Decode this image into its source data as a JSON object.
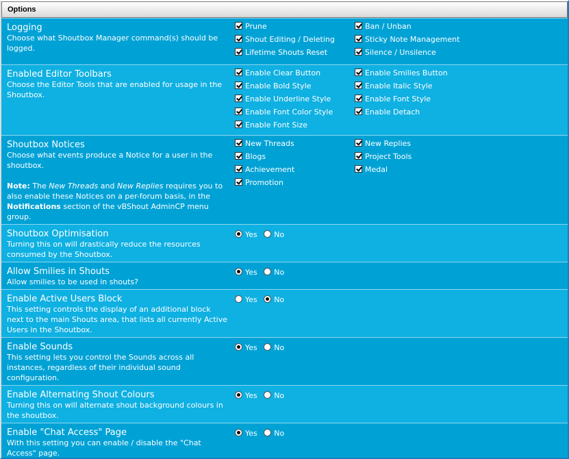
{
  "section_title": "Options",
  "logging": {
    "title": "Logging",
    "desc": "Choose what Shoutbox Manager command(s) should be logged.",
    "options": [
      "Prune",
      "Ban / Unban",
      "Shout Editing / Deleting",
      "Sticky Note Management",
      "Lifetime Shouts Reset",
      "Silence / Unsilence"
    ]
  },
  "toolbars": {
    "title": "Enabled Editor Toolbars",
    "desc": "Choose the Editor Tools that are enabled for usage in the Shoutbox.",
    "options": [
      "Enable Clear Button",
      "Enable Smilies Button",
      "Enable Bold Style",
      "Enable Italic Style",
      "Enable Underline Style",
      "Enable Font Style",
      "Enable Font Color Style",
      "Enable Detach",
      "Enable Font Size"
    ]
  },
  "notices": {
    "title": "Shoutbox Notices",
    "desc": "Choose what events produce a Notice for a user in the shoutbox.",
    "note_label": "Note:",
    "note_t1": " The ",
    "note_new_threads": "New Threads",
    "note_t2": " and ",
    "note_new_replies": "New Replies",
    "note_t3": " requires you to also enable these Notices on a per-forum basis, in the ",
    "note_notifications": "Notifications",
    "note_t4": " section of the vBShout AdminCP menu group.",
    "options": [
      "New Threads",
      "New Replies",
      "Blogs",
      "Project Tools",
      "Achievement",
      "Medal",
      "Promotion"
    ]
  },
  "yes_label": "Yes",
  "no_label": "No",
  "radio_settings": [
    {
      "title": "Shoutbox Optimisation",
      "desc": "Turning this on will drastically reduce the resources consumed by the Shoutbox.",
      "value": "yes"
    },
    {
      "title": "Allow Smilies in Shouts",
      "desc": "Allow smilies to be used in shouts?",
      "value": "yes"
    },
    {
      "title": "Enable Active Users Block",
      "desc": "This setting controls the display of an additional block next to the main Shouts area, that lists all currently Active Users in the Shoutbox.",
      "value": "no"
    },
    {
      "title": "Enable Sounds",
      "desc": "This setting lets you control the Sounds across all instances, regardless of their individual sound configuration.",
      "value": "yes"
    },
    {
      "title": "Enable Alternating Shout Colours",
      "desc": "Turning this on will alternate shout background colours in the shoutbox.",
      "value": "yes"
    },
    {
      "title": "Enable \"Chat Access\" Page",
      "desc": "With this setting you can enable / disable the \"Chat Access\" page.",
      "value": "yes"
    }
  ]
}
